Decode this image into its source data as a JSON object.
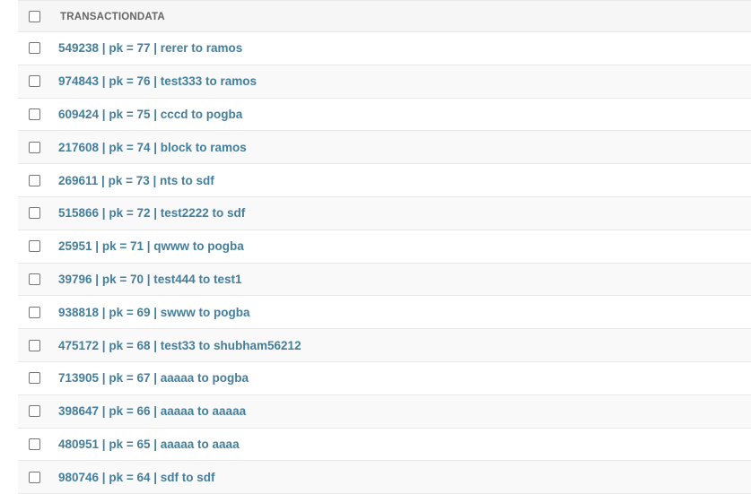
{
  "table": {
    "header": "TRANSACTIONDATA",
    "rows": [
      {
        "label": "549238 | pk = 77 | rerer to ramos"
      },
      {
        "label": "974843 | pk = 76 | test333 to ramos"
      },
      {
        "label": "609424 | pk = 75 | cccd to pogba"
      },
      {
        "label": "217608 | pk = 74 | block to ramos"
      },
      {
        "label": "269611 | pk = 73 | nts to sdf"
      },
      {
        "label": "515866 | pk = 72 | test2222 to sdf"
      },
      {
        "label": "25951 | pk = 71 | qwww to pogba"
      },
      {
        "label": "39796 | pk = 70 | test444 to test1"
      },
      {
        "label": "938818 | pk = 69 | swww to pogba"
      },
      {
        "label": "475172 | pk = 68 | test33 to shubham56212"
      },
      {
        "label": "713905 | pk = 67 | aaaaa to pogba"
      },
      {
        "label": "398647 | pk = 66 | aaaaa to aaaaa"
      },
      {
        "label": "480951 | pk = 65 | aaaaa to aaaa"
      },
      {
        "label": "980746 | pk = 64 | sdf to sdf"
      }
    ]
  },
  "colors": {
    "link": "#447e9b",
    "header_text": "#666666",
    "header_bg": "#f6f6f6",
    "alt_row_bg": "#f9f9f9"
  }
}
